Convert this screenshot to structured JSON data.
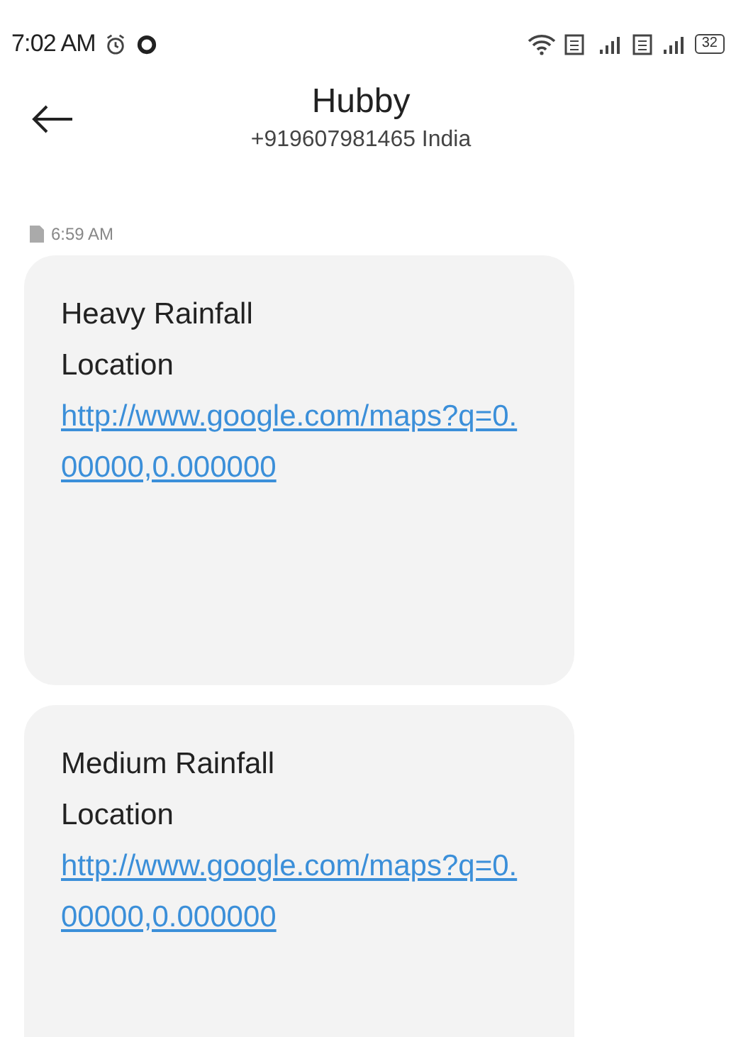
{
  "status_bar": {
    "time": "7:02 AM",
    "battery": "32"
  },
  "header": {
    "title": "Hubby",
    "subtitle": "+919607981465 India"
  },
  "timestamp": "6:59 AM",
  "messages": [
    {
      "lines": [
        "Heavy Rainfall",
        "Location"
      ],
      "link": "http://www.google.com/maps?q=0.00000,0.000000"
    },
    {
      "lines": [
        "Medium Rainfall",
        "Location"
      ],
      "link": "http://www.google.com/maps?q=0.00000,0.000000"
    }
  ]
}
